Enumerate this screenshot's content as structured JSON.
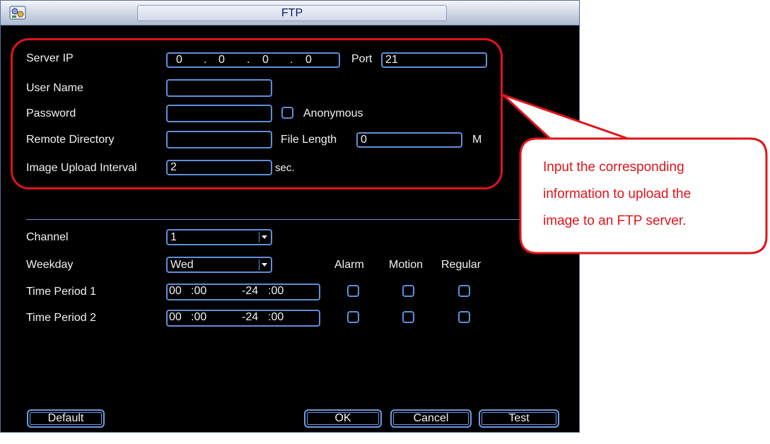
{
  "window": {
    "title": "FTP",
    "app_icon": "settings-app-icon"
  },
  "server": {
    "server_ip_label": "Server IP",
    "ip_octets": [
      "0",
      "0",
      "0",
      "0"
    ],
    "ip_separator": ".",
    "port_label": "Port",
    "port_value": "21",
    "user_name_label": "User Name",
    "user_name_value": "",
    "password_label": "Password",
    "password_value": "",
    "anonymous_label": "Anonymous",
    "anonymous_checked": false,
    "remote_dir_label": "Remote Directory",
    "remote_dir_value": "",
    "file_length_label": "File Length",
    "file_length_value": "0",
    "file_length_unit": "M",
    "interval_label": "Image Upload Interval",
    "interval_value": "2",
    "interval_unit": "sec."
  },
  "schedule": {
    "channel_label": "Channel",
    "channel_value": "1",
    "weekday_label": "Weekday",
    "weekday_value": "Wed",
    "col_alarm": "Alarm",
    "col_motion": "Motion",
    "col_regular": "Regular",
    "periods": [
      {
        "label": "Time Period 1",
        "start_h": "00",
        "start_m": ":00",
        "end_h": "-24",
        "end_m": ":00",
        "alarm": false,
        "motion": false,
        "regular": false
      },
      {
        "label": "Time Period 2",
        "start_h": "00",
        "start_m": ":00",
        "end_h": "-24",
        "end_m": ":00",
        "alarm": false,
        "motion": false,
        "regular": false
      }
    ]
  },
  "buttons": {
    "default": "Default",
    "ok": "OK",
    "cancel": "Cancel",
    "test": "Test"
  },
  "callout": {
    "lines": [
      "Input the corresponding",
      "information to upload the",
      "image to an FTP server."
    ],
    "color": "#e0141b"
  },
  "colors": {
    "field_border": "#5f8fd8",
    "background": "#000000",
    "text": "#f2f2f2"
  }
}
